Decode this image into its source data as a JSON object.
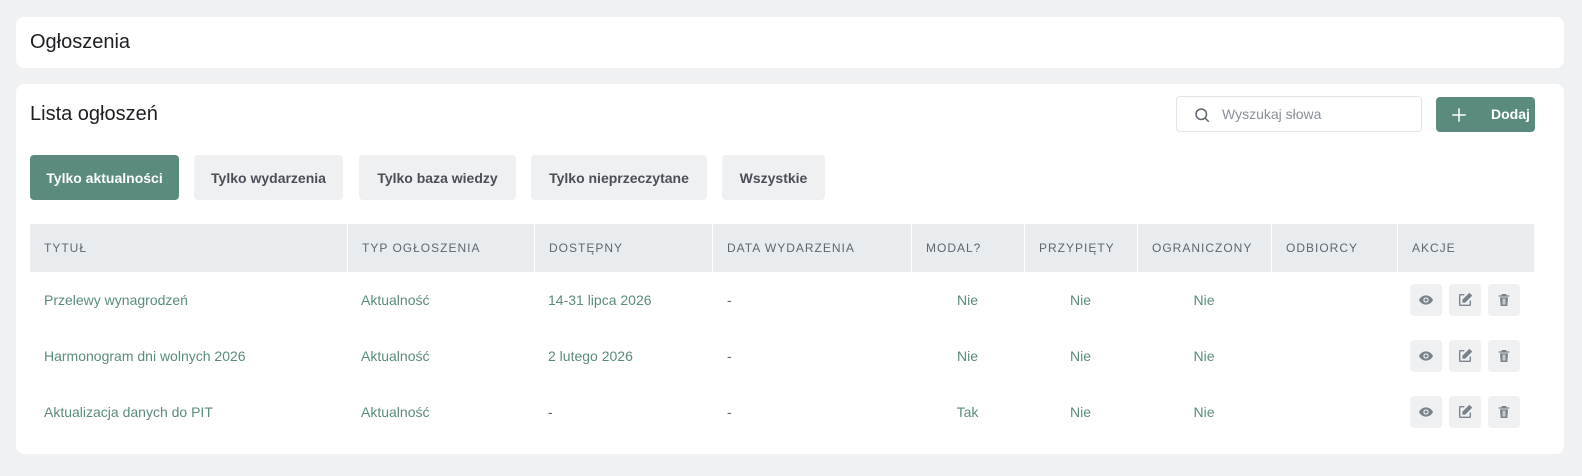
{
  "page_title": "Ogłoszenia",
  "list": {
    "title": "Lista ogłoszeń",
    "search_placeholder": "Wyszukaj słowa",
    "search_value": "",
    "add_label": "Dodaj"
  },
  "filters": [
    {
      "label": "Tylko aktualności",
      "active": true
    },
    {
      "label": "Tylko wydarzenia",
      "active": false
    },
    {
      "label": "Tylko baza wiedzy",
      "active": false
    },
    {
      "label": "Tylko nieprzeczytane",
      "active": false
    },
    {
      "label": "Wszystkie",
      "active": false
    }
  ],
  "table": {
    "headers": [
      "TYTUŁ",
      "TYP OGŁOSZENIA",
      "DOSTĘPNY",
      "DATA WYDARZENIA",
      "MODAL?",
      "PRZYPIĘTY",
      "OGRANICZONY",
      "ODBIORCY",
      "AKCJE"
    ],
    "rows": [
      {
        "title": "Przelewy wynagrodzeń",
        "type": "Aktualność",
        "available": "14-31 lipca 2026",
        "event_date": "-",
        "modal": "Nie",
        "pinned": "Nie",
        "restricted": "Nie",
        "recipients": ""
      },
      {
        "title": "Harmonogram dni wolnych 2026",
        "type": "Aktualność",
        "available": "2 lutego 2026",
        "event_date": "-",
        "modal": "Nie",
        "pinned": "Nie",
        "restricted": "Nie",
        "recipients": ""
      },
      {
        "title": "Aktualizacja danych do PIT",
        "type": "Aktualność",
        "available": "-",
        "event_date": "-",
        "modal": "Tak",
        "pinned": "Nie",
        "restricted": "Nie",
        "recipients": ""
      }
    ]
  },
  "icons": {
    "search": "search-icon",
    "add": "plus-icon",
    "view": "eye-icon",
    "edit": "edit-icon",
    "delete": "trash-icon"
  },
  "colors": {
    "accent": "#5a8b7e",
    "background": "#f0f1f3",
    "header_bg": "#e9ecef",
    "button_gray": "#eef0f2"
  }
}
